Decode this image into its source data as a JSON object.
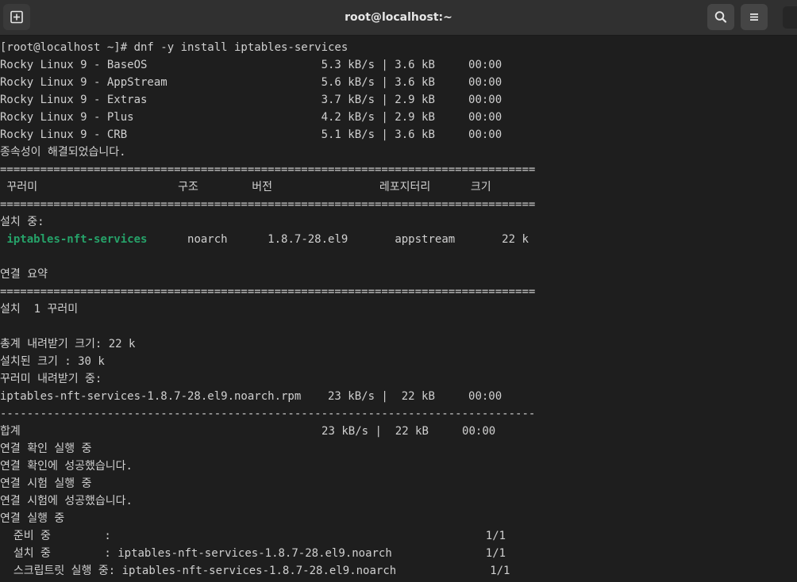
{
  "window": {
    "title": "root@localhost:~",
    "new_tab_icon": "new-tab-icon",
    "search_icon": "search-icon",
    "menu_icon": "hamburger-menu-icon"
  },
  "colors": {
    "background": "#1e1e1e",
    "text": "#d0d0d0",
    "package_highlight": "#26a269"
  },
  "terminal": {
    "lines": [
      {
        "text": "[root@localhost ~]# dnf -y install iptables-services"
      },
      {
        "text": "Rocky Linux 9 - BaseOS                          5.3 kB/s | 3.6 kB     00:00"
      },
      {
        "text": "Rocky Linux 9 - AppStream                       5.6 kB/s | 3.6 kB     00:00"
      },
      {
        "text": "Rocky Linux 9 - Extras                          3.7 kB/s | 2.9 kB     00:00"
      },
      {
        "text": "Rocky Linux 9 - Plus                            4.2 kB/s | 2.9 kB     00:00"
      },
      {
        "text": "Rocky Linux 9 - CRB                             5.1 kB/s | 3.6 kB     00:00"
      },
      {
        "text": "종속성이 해결되었습니다."
      },
      {
        "text": "================================================================================"
      },
      {
        "text": " 꾸러미                     구조        버전                레포지터리      크기"
      },
      {
        "text": "================================================================================"
      },
      {
        "text": "설치 중:"
      },
      {
        "pre": " ",
        "highlight": "iptables-nft-services",
        "post": "      noarch      1.8.7-28.el9       appstream       22 k"
      },
      {
        "text": ""
      },
      {
        "text": "연결 요약"
      },
      {
        "text": "================================================================================"
      },
      {
        "text": "설치  1 꾸러미"
      },
      {
        "text": ""
      },
      {
        "text": "총계 내려받기 크기: 22 k"
      },
      {
        "text": "설치된 크기 : 30 k"
      },
      {
        "text": "꾸러미 내려받기 중:"
      },
      {
        "text": "iptables-nft-services-1.8.7-28.el9.noarch.rpm    23 kB/s |  22 kB     00:00"
      },
      {
        "text": "--------------------------------------------------------------------------------"
      },
      {
        "text": "합계                                             23 kB/s |  22 kB     00:00"
      },
      {
        "text": "연결 확인 실행 중"
      },
      {
        "text": "연결 확인에 성공했습니다."
      },
      {
        "text": "연결 시험 실행 중"
      },
      {
        "text": "연결 시험에 성공했습니다."
      },
      {
        "text": "연결 실행 중"
      },
      {
        "text": "  준비 중        :                                                        1/1"
      },
      {
        "text": "  설치 중        : iptables-nft-services-1.8.7-28.el9.noarch              1/1"
      },
      {
        "text": "  스크립트릿 실행 중: iptables-nft-services-1.8.7-28.el9.noarch              1/1"
      }
    ]
  }
}
